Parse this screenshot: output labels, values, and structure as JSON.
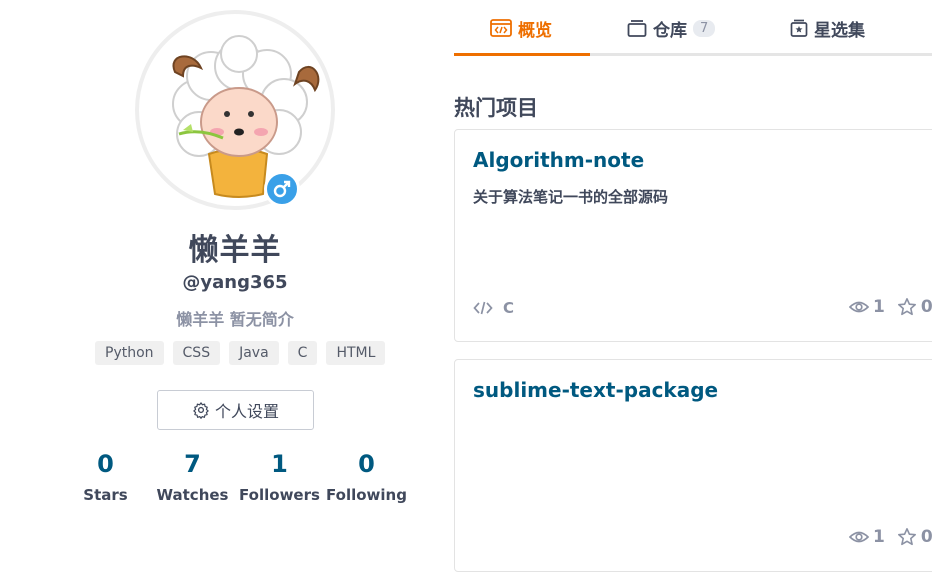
{
  "profile": {
    "display_name": "懒羊羊",
    "username": "@yang365",
    "bio": "懒羊羊 暂无简介",
    "languages": [
      "Python",
      "CSS",
      "Java",
      "C",
      "HTML"
    ],
    "settings_label": "个人设置",
    "stats": [
      {
        "value": "0",
        "label": "Stars"
      },
      {
        "value": "7",
        "label": "Watches"
      },
      {
        "value": "1",
        "label": "Followers"
      },
      {
        "value": "0",
        "label": "Following"
      }
    ]
  },
  "tabs": [
    {
      "label": "概览",
      "icon": "overview-icon",
      "active": true
    },
    {
      "label": "仓库",
      "icon": "repo-icon",
      "count": "7"
    },
    {
      "label": "星选集",
      "icon": "star-collection-icon"
    }
  ],
  "section_title": "热门项目",
  "repos": [
    {
      "name": "Algorithm-note",
      "description": "关于算法笔记一书的全部源码",
      "language": "C",
      "watches": "1",
      "stars": "0"
    },
    {
      "name": "sublime-text-package",
      "description": "",
      "language": "",
      "watches": "1",
      "stars": "0"
    }
  ],
  "colors": {
    "accent": "#ee6f00",
    "link": "#005980",
    "badge": "#3aa0e8"
  }
}
